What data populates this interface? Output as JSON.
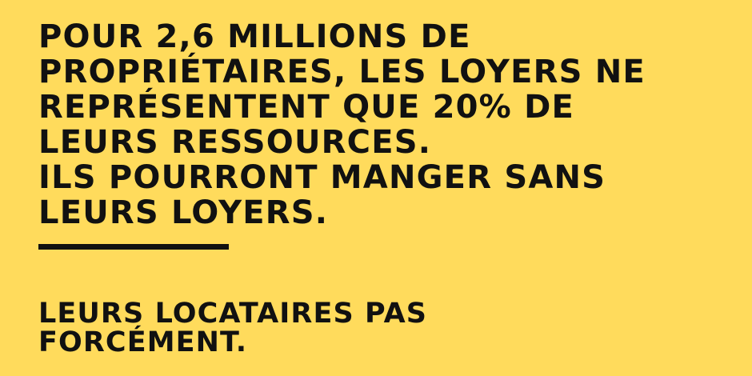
{
  "theme": {
    "background": "#FFDB5C",
    "text_color": "#111111"
  },
  "headline": {
    "lines": [
      "POUR 2,6 MILLIONS DE",
      "PROPRIÉTAIRES, LES LOYERS NE",
      "REPRÉSENTENT QUE 20% DE",
      "LEURS RESSOURCES.",
      "ILS POURRONT MANGER SANS",
      "LEURS LOYERS."
    ]
  },
  "footer": {
    "lines": [
      "LEURS LOCATAIRES PAS",
      "FORCÉMENT."
    ]
  }
}
